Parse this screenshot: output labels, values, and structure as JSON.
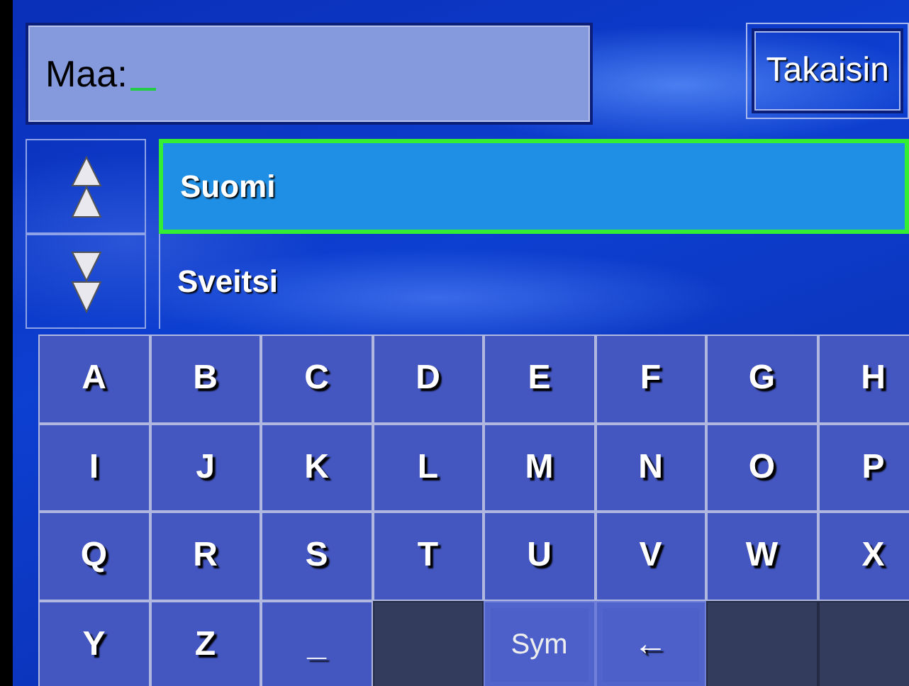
{
  "search": {
    "label": "Maa:"
  },
  "back_button": {
    "label": "Takaisin"
  },
  "list": [
    {
      "label": "Suomi",
      "selected": true
    },
    {
      "label": "Sveitsi",
      "selected": false
    }
  ],
  "keyboard": [
    [
      {
        "kind": "letter",
        "label": "A"
      },
      {
        "kind": "letter",
        "label": "B"
      },
      {
        "kind": "letter",
        "label": "C"
      },
      {
        "kind": "letter",
        "label": "D"
      },
      {
        "kind": "letter",
        "label": "E"
      },
      {
        "kind": "letter",
        "label": "F"
      },
      {
        "kind": "letter",
        "label": "G"
      },
      {
        "kind": "letter",
        "label": "H"
      }
    ],
    [
      {
        "kind": "letter",
        "label": "I"
      },
      {
        "kind": "letter",
        "label": "J"
      },
      {
        "kind": "letter",
        "label": "K"
      },
      {
        "kind": "letter",
        "label": "L"
      },
      {
        "kind": "letter",
        "label": "M"
      },
      {
        "kind": "letter",
        "label": "N"
      },
      {
        "kind": "letter",
        "label": "O"
      },
      {
        "kind": "letter",
        "label": "P"
      }
    ],
    [
      {
        "kind": "letter",
        "label": "Q"
      },
      {
        "kind": "letter",
        "label": "R"
      },
      {
        "kind": "letter",
        "label": "S"
      },
      {
        "kind": "letter",
        "label": "T"
      },
      {
        "kind": "letter",
        "label": "U"
      },
      {
        "kind": "letter",
        "label": "V"
      },
      {
        "kind": "letter",
        "label": "W"
      },
      {
        "kind": "letter",
        "label": "X"
      }
    ],
    [
      {
        "kind": "letter",
        "label": "Y"
      },
      {
        "kind": "letter",
        "label": "Z"
      },
      {
        "kind": "letter",
        "label": "_"
      },
      {
        "kind": "blank"
      },
      {
        "kind": "function",
        "label": "Sym"
      },
      {
        "kind": "function",
        "label": "←"
      },
      {
        "kind": "blank"
      },
      {
        "kind": "blank"
      }
    ]
  ]
}
